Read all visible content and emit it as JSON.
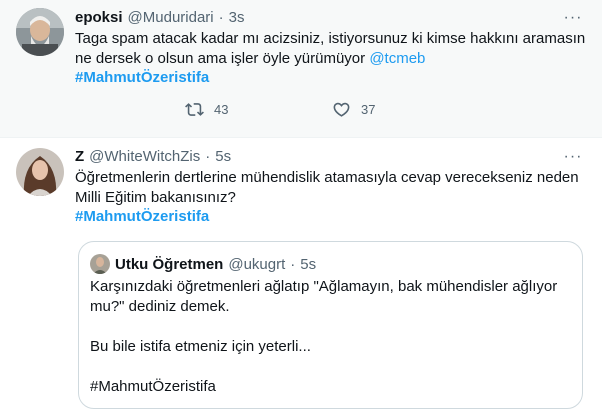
{
  "tweet1": {
    "display_name": "epoksi",
    "handle": "@Muduridari",
    "separator": "·",
    "time": "3s",
    "text_line1": "Taga spam atacak kadar mı acizsiniz, istiyorsunuz ki kimse hakkını aramasın",
    "text_line2_pre": "ne dersek o olsun ama işler öyle yürümüyor ",
    "mention": "@tcmeb",
    "hashtag": "#MahmutÖzeristifa",
    "retweet_count": "43",
    "like_count": "37",
    "more_icon": "more-horizontal-icon",
    "retweet_icon": "retweet-icon",
    "like_icon": "heart-icon"
  },
  "tweet2": {
    "display_name": "Z",
    "handle": "@WhiteWitchZis",
    "separator": "·",
    "time": "5s",
    "text_line1": "Öğretmenlerin dertlerine mühendislik atamasıyla cevap verecekseniz neden",
    "text_line2": "Milli Eğitim bakanısınız?",
    "hashtag": "#MahmutÖzeristifa",
    "more_icon": "more-horizontal-icon"
  },
  "quote": {
    "display_name": "Utku Öğretmen",
    "handle": "@ukugrt",
    "separator": "·",
    "time": "5s",
    "line1": "Karşınızdaki öğretmenleri ağlatıp \"Ağlamayın, bak mühendisler ağlıyor",
    "line2": "mu?\" dediniz demek.",
    "line3": "Bu bile istifa etmeniz için yeterli...",
    "line4": "#MahmutÖzeristifa"
  },
  "colors": {
    "accent": "#1d9bf0",
    "text": "#0f1419",
    "muted": "#536471",
    "highlight_bg": "#f7f9f9",
    "border": "#cfd9de"
  }
}
